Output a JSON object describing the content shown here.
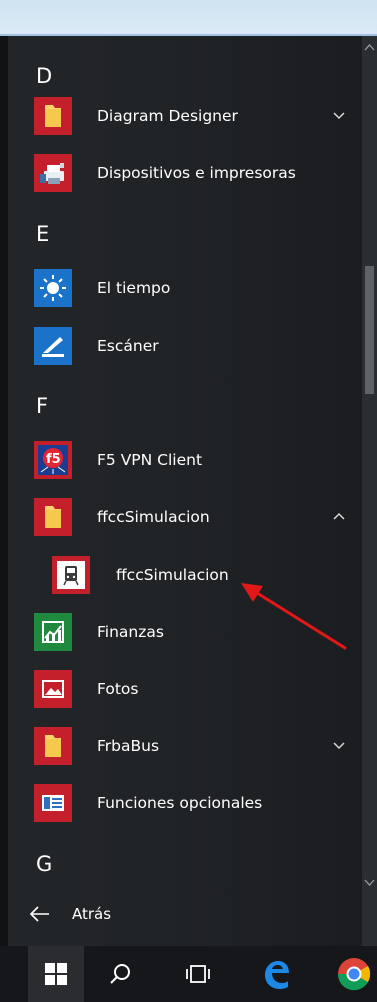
{
  "sections": [
    {
      "letter": "D"
    },
    {
      "letter": "E"
    },
    {
      "letter": "F"
    },
    {
      "letter": "G"
    }
  ],
  "apps": {
    "diagram_designer": {
      "label": "Diagram Designer",
      "tile_color": "#c3202c",
      "icon": "folder-icon",
      "expandable": true
    },
    "dispositivos": {
      "label": "Dispositivos e impresoras",
      "tile_color": "#c3202c",
      "icon": "printer-icon"
    },
    "el_tiempo": {
      "label": "El tiempo",
      "tile_color": "#1a73c9",
      "icon": "sun-icon"
    },
    "escaner": {
      "label": "Escáner",
      "tile_color": "#1a73c9",
      "icon": "scanner-icon"
    },
    "f5_vpn": {
      "label": "F5 VPN Client",
      "tile_color": "#c3202c",
      "icon": "f5-logo-icon"
    },
    "ffcc_folder": {
      "label": "ffccSimulacion",
      "tile_color": "#c3202c",
      "icon": "folder-icon",
      "expanded": true
    },
    "ffcc_app": {
      "label": "ffccSimulacion",
      "tile_color": "#c3202c",
      "icon": "train-icon"
    },
    "finanzas": {
      "label": "Finanzas",
      "tile_color": "#1f8a3d",
      "icon": "chart-icon"
    },
    "fotos": {
      "label": "Fotos",
      "tile_color": "#c3202c",
      "icon": "photo-icon"
    },
    "frbabus": {
      "label": "FrbaBus",
      "tile_color": "#c3202c",
      "icon": "folder-icon",
      "expandable": true
    },
    "funciones": {
      "label": "Funciones opcionales",
      "tile_color": "#c3202c",
      "icon": "features-icon"
    }
  },
  "back": {
    "label": "Atrás"
  },
  "taskbar": {
    "items": [
      "windows-start-icon",
      "search-icon",
      "task-view-icon",
      "edge-icon",
      "chrome-icon"
    ]
  },
  "colors": {
    "accent_red": "#c3202c",
    "accent_blue": "#1a73c9",
    "annotation_arrow": "#e01818"
  }
}
